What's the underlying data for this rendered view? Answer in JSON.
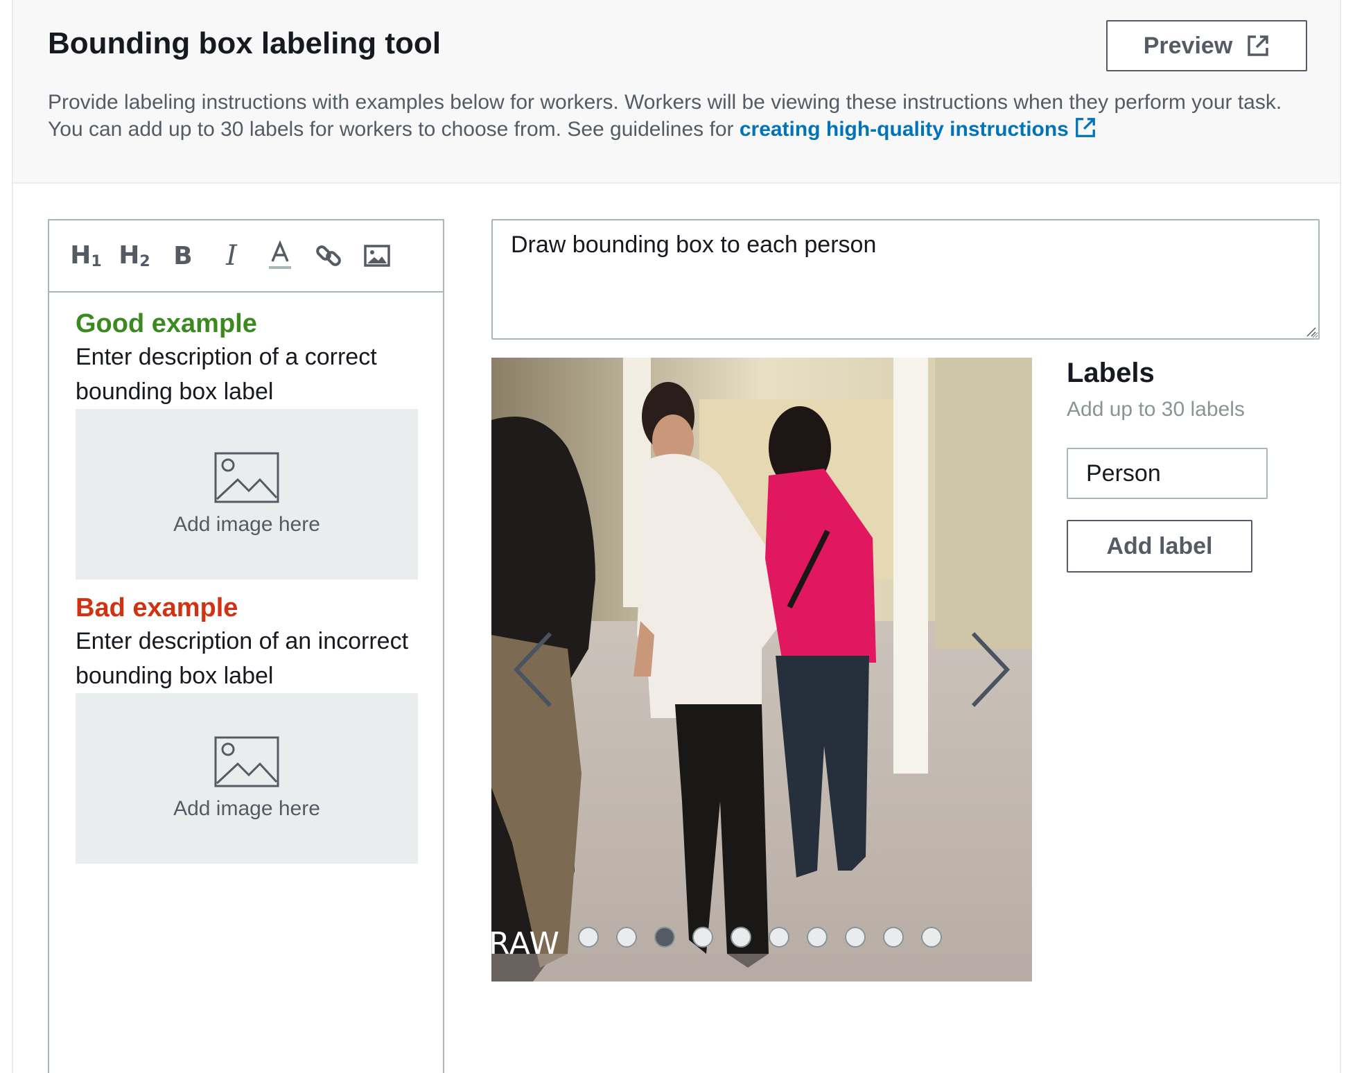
{
  "header": {
    "title": "Bounding box labeling tool",
    "preview_label": "Preview",
    "description": "Provide labeling instructions with examples below for workers. Workers will be viewing these instructions when they perform your task. You can add up to 30 labels for workers to choose from. See guidelines for ",
    "guidelines_link": "creating high-quality instructions"
  },
  "toolbar": {
    "items": [
      "H1",
      "H2",
      "B",
      "I",
      "A"
    ],
    "icons": [
      "heading1-icon",
      "heading2-icon",
      "bold-icon",
      "italic-icon",
      "font-color-icon",
      "link-icon",
      "image-icon"
    ]
  },
  "editor": {
    "good_title": "Good example",
    "good_desc": "Enter description of a correct bounding box label",
    "bad_title": "Bad example",
    "bad_desc": "Enter description of an incorrect bounding box label",
    "add_image": "Add image here"
  },
  "instruction": {
    "value": "Draw bounding box to each person"
  },
  "carousel": {
    "watermark": "RAW",
    "dot_count": 10,
    "active_index": 2
  },
  "labels": {
    "title": "Labels",
    "subtitle": "Add up to 30 labels",
    "items": [
      "Person"
    ],
    "add_label": "Add label"
  },
  "colors": {
    "link": "#0073bb",
    "good": "#3b8a1f",
    "bad": "#d13212",
    "secondary_text": "#545b64"
  }
}
